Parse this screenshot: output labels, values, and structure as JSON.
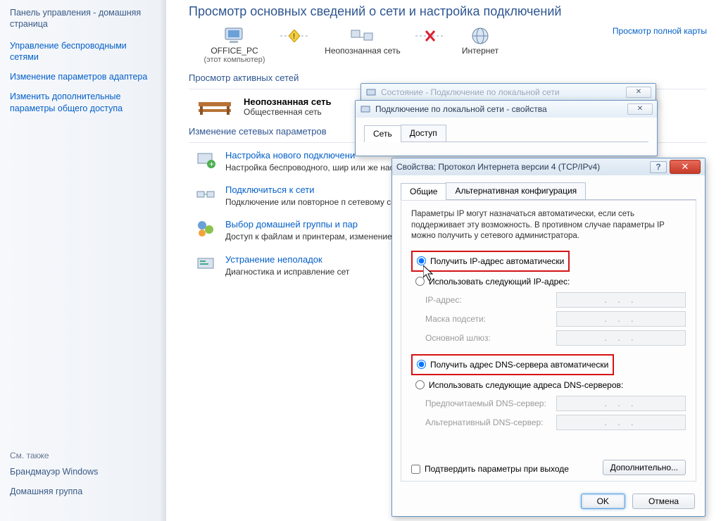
{
  "sidebar": {
    "home": "Панель управления - домашняя страница",
    "links": [
      "Управление беспроводными сетями",
      "Изменение параметров адаптера",
      "Изменить дополнительные параметры общего доступа"
    ],
    "see_also_head": "См. также",
    "see_also": [
      "Брандмауэр Windows",
      "Домашняя группа"
    ]
  },
  "main": {
    "title": "Просмотр основных сведений о сети и настройка подключений",
    "map_link": "Просмотр полной карты",
    "nodes": {
      "pc": "OFFICE_PC",
      "pc_sub": "(этот компьютер)",
      "unknown": "Неопознанная сеть",
      "internet": "Интернет"
    },
    "section_active": "Просмотр активных сетей",
    "network": {
      "name": "Неопознанная сеть",
      "type": "Общественная сеть"
    },
    "section_change": "Изменение сетевых параметров",
    "tasks": [
      {
        "link": "Настройка нового подключени",
        "desc": "Настройка беспроводного, шир\nили же настройка маршрутизат"
      },
      {
        "link": "Подключиться к сети",
        "desc": "Подключение или повторное п\nсетевому соединению или подк"
      },
      {
        "link": "Выбор домашней группы и пар",
        "desc": "Доступ к файлам и принтерам,\nизменение параметров общего"
      },
      {
        "link": "Устранение неполадок",
        "desc": "Диагностика и исправление сет"
      }
    ]
  },
  "dlg1": {
    "title": "Состояние - Подключение по локальной сети"
  },
  "dlg2": {
    "title": "Подключение по локальной сети - свойства",
    "tabs": [
      "Сеть",
      "Доступ"
    ]
  },
  "dlg3": {
    "title": "Свойства: Протокол Интернета версии 4 (TCP/IPv4)",
    "tabs": [
      "Общие",
      "Альтернативная конфигурация"
    ],
    "info": "Параметры IP могут назначаться автоматически, если сеть поддерживает эту возможность. В противном случае параметры IP можно получить у сетевого администратора.",
    "r_ip_auto": "Получить IP-адрес автоматически",
    "r_ip_manual": "Использовать следующий IP-адрес:",
    "f_ip": "IP-адрес:",
    "f_mask": "Маска подсети:",
    "f_gw": "Основной шлюз:",
    "r_dns_auto": "Получить адрес DNS-сервера автоматически",
    "r_dns_manual": "Использовать следующие адреса DNS-серверов:",
    "f_dns1": "Предпочитаемый DNS-сервер:",
    "f_dns2": "Альтернативный DNS-сервер:",
    "chk_confirm": "Подтвердить параметры при выходе",
    "btn_adv": "Дополнительно...",
    "btn_ok": "OK",
    "btn_cancel": "Отмена"
  }
}
